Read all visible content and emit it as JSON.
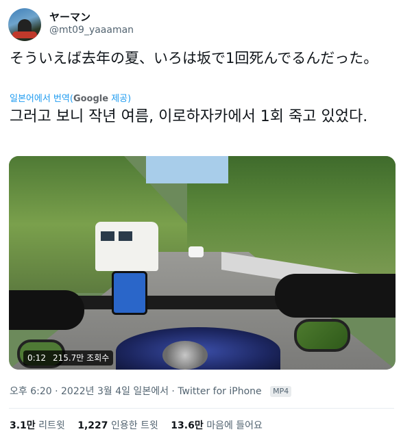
{
  "author": {
    "name": "ヤーマン",
    "handle": "@mt09_yaaaman"
  },
  "tweet": {
    "original_text": "そういえば去年の夏、いろは坂で1回死んでるんだった。",
    "translation_note_prefix": "일본어에서 번역(",
    "translation_provider": "Google",
    "translation_note_suffix": " 제공)",
    "translated_text": "그러고 보니 작년 여름, 이로하자카에서 1회 죽고 있었다."
  },
  "media": {
    "duration": "0:12",
    "views": "215.7만 조회수",
    "format_badge": "MP4"
  },
  "meta": {
    "timestamp": "오후 6:20 · 2022년 3월 4일 일본에서 ·",
    "client": "Twitter for iPhone"
  },
  "stats": [
    {
      "count": "3.1만",
      "label": "리트윗"
    },
    {
      "count": "1,227",
      "label": "인용한 트윗"
    },
    {
      "count": "13.6만",
      "label": "마음에 들어요"
    }
  ]
}
